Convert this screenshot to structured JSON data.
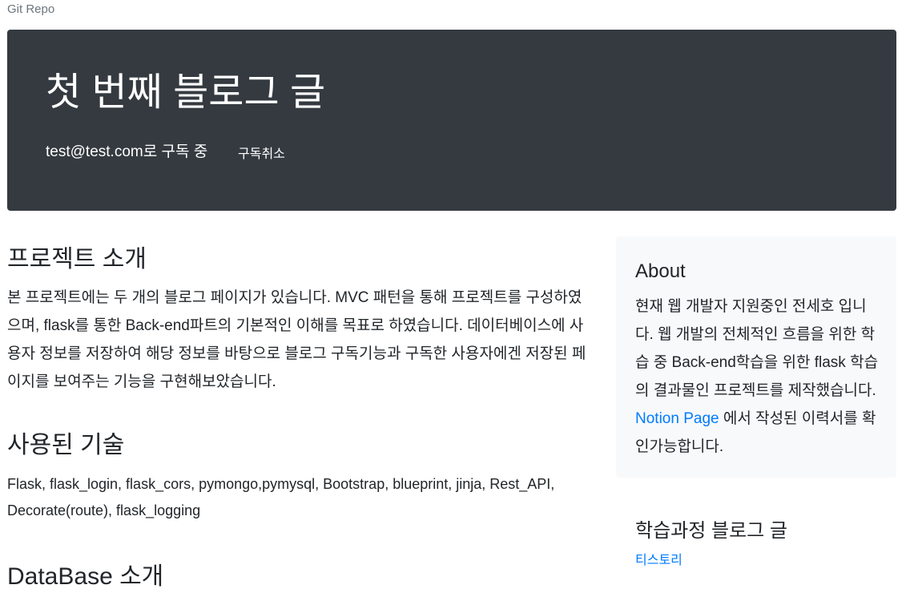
{
  "top_nav": {
    "repo_link": "Git Repo"
  },
  "hero": {
    "title": "첫 번째 블로그 글",
    "subscription_text": "test@test.com로 구독 중",
    "unsubscribe_label": "구독취소"
  },
  "main": {
    "intro_heading": "프로젝트 소개",
    "intro_text": "본 프로젝트에는 두 개의 블로그 페이지가 있습니다. MVC 패턴을 통해 프로젝트를 구성하였으며, flask를 통한 Back-end파트의 기본적인 이해를 목표로 하였습니다. 데이터베이스에 사용자 정보를 저장하여 해당 정보를 바탕으로 블로그 구독기능과 구독한 사용자에겐 저장된 페이지를 보여주는 기능을 구현해보았습니다.",
    "tech_heading": "사용된 기술",
    "tech_text": "Flask, flask_login, flask_cors, pymongo,pymysql, Bootstrap, blueprint, jinja, Rest_API, Decorate(route), flask_logging",
    "db_heading": "DataBase 소개"
  },
  "sidebar": {
    "about_heading": "About",
    "about_text_before": "현재 웹 개발자 지원중인 전세호 입니다. 웹 개발의 전체적인 흐름을 위한 학습 중 Back-end학습을 위한 flask 학습의 결과물인 프로젝트를 제작했습니다. ",
    "notion_link": "Notion Page",
    "about_text_after": " 에서 작성된 이력서를 확인가능합니다.",
    "study_heading": "학습과정 블로그 글",
    "tistory_link": "티스토리"
  },
  "colors": {
    "hero_bg": "#343a40",
    "link": "#007bff",
    "sidebar_bg": "#f8f9fa"
  }
}
